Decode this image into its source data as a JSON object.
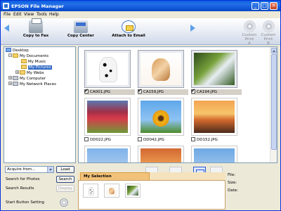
{
  "window": {
    "title": "EPSON File Manager",
    "controls": {
      "minimize": "_",
      "maximize": "□",
      "close": "✕"
    }
  },
  "menu": [
    "File",
    "Edit",
    "View",
    "Tools",
    "Help"
  ],
  "toolbar": {
    "copy_to_fax": "Copy to Fax",
    "copy_center": "Copy Center",
    "attach_to_email": "Attach to Email",
    "custom_print_a": "Custom Print\nA",
    "custom_print_b": "Custom Print\nB"
  },
  "tree": {
    "desktop": "Desktop",
    "my_documents": "My Documents",
    "my_music": "My Music",
    "my_pictures": "My Pictures",
    "my_webs": "My Webs",
    "my_computer": "My Computer",
    "my_network_places": "My Network Places"
  },
  "thumbnails": [
    {
      "name": "CA001.JPG",
      "checked": true,
      "selected": true,
      "photo": "dog"
    },
    {
      "name": "CA159.JPG",
      "checked": true,
      "selected": true,
      "photo": "cat"
    },
    {
      "name": "CA194.JPG",
      "checked": true,
      "selected": true,
      "photo": "plant"
    },
    {
      "name": "DD022.JPG",
      "checked": false,
      "selected": false,
      "photo": "tulip"
    },
    {
      "name": "DD042.JPG",
      "checked": false,
      "selected": false,
      "photo": "sunflower"
    },
    {
      "name": "DD152.JPG",
      "checked": false,
      "selected": false,
      "photo": "sunset"
    },
    {
      "name": "",
      "checked": false,
      "selected": false,
      "photo": "sky1"
    },
    {
      "name": "",
      "checked": false,
      "selected": false,
      "photo": "sky2"
    },
    {
      "name": "",
      "checked": false,
      "selected": false,
      "photo": "sky3"
    }
  ],
  "controls": {
    "acquire_dropdown": "Acquire from...",
    "load_button": "Load",
    "search_label": "Search for Photos",
    "search_button": "Search",
    "results_label": "Search Results",
    "display_button": "Display",
    "start_label": "Start Button Setting"
  },
  "my_selection": {
    "title": "My Selection",
    "items": [
      "dog",
      "cat",
      "plant"
    ]
  },
  "info": {
    "file_label": "File:",
    "size_label": "Size:",
    "date_label": "Date:"
  },
  "colors": {
    "titlebar": "#0a5fe0",
    "selection_tab": "#f3c27a",
    "tree_highlight": "#316ac5"
  }
}
